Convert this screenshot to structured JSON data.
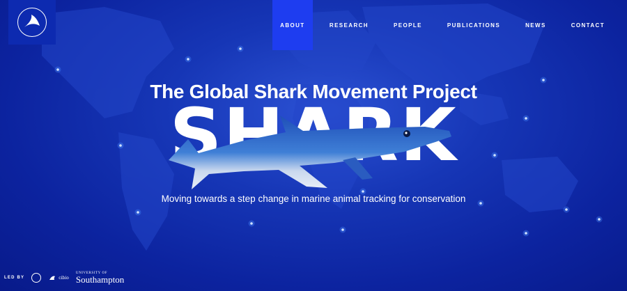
{
  "brand": {
    "logo_text": "Global Shark Movement"
  },
  "nav": {
    "items": [
      {
        "label": "ABOUT",
        "active": true
      },
      {
        "label": "RESEARCH",
        "active": false
      },
      {
        "label": "PEOPLE",
        "active": false
      },
      {
        "label": "PUBLICATIONS",
        "active": false
      },
      {
        "label": "NEWS",
        "active": false
      },
      {
        "label": "CONTACT",
        "active": false
      }
    ]
  },
  "hero": {
    "title": "The Global Shark Movement Project",
    "big_word": "SHARK",
    "subtitle": "Moving towards a step change in marine animal tracking for conservation"
  },
  "footer": {
    "led_by": "LED BY",
    "partner_logos": [
      "mba-logo",
      "cibio-logo",
      "university-of-southampton-logo"
    ],
    "cibio_text": "cibio",
    "university_top": "UNIVERSITY OF",
    "university_main": "Southampton"
  },
  "colors": {
    "background": "#0c239f",
    "nav_active": "#1e3df0",
    "text": "#ffffff"
  }
}
